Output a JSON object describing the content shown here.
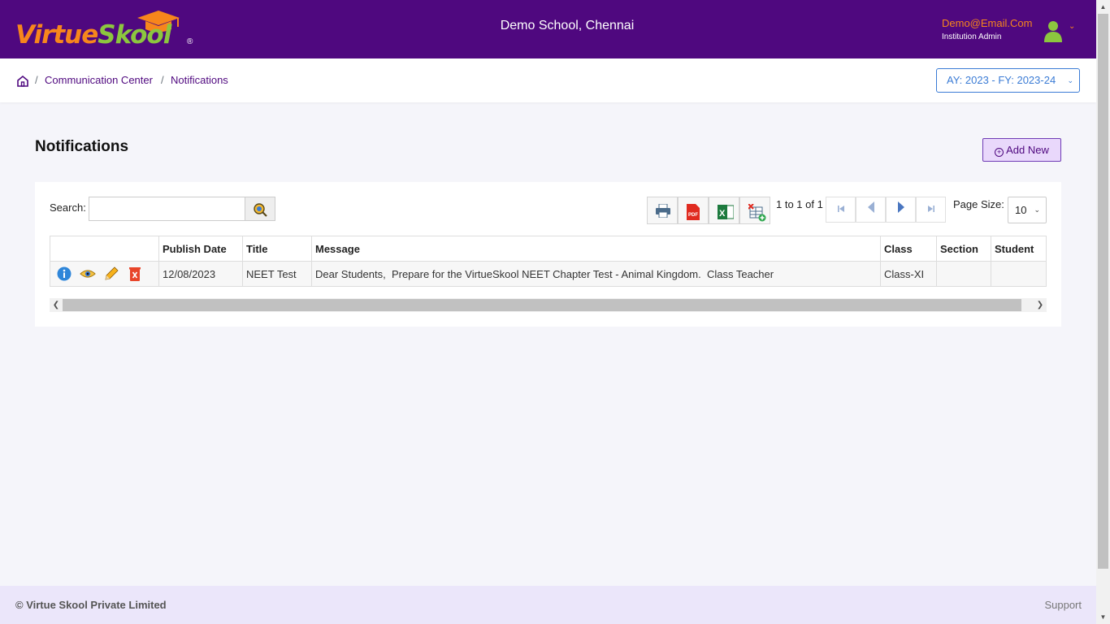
{
  "header": {
    "logo": {
      "part1": "Virtue",
      "part2": "Skool",
      "reg": "®"
    },
    "school_name": "Demo School, Chennai",
    "user_email": "Demo@Email.Com",
    "user_role": "Institution Admin"
  },
  "breadcrumb": {
    "items": [
      "Communication Center",
      "Notifications"
    ],
    "separator": "/"
  },
  "year_selector": {
    "value": "AY: 2023 - FY: 2023-24"
  },
  "main": {
    "title": "Notifications",
    "add_label": "Add New"
  },
  "grid": {
    "search_label": "Search:",
    "search_value": "",
    "pager_info": "1 to 1 of 1",
    "page_size_label": "Page Size:",
    "page_size": "10",
    "columns": [
      "",
      "Publish Date",
      "Title",
      "Message",
      "Class",
      "Section",
      "Student"
    ],
    "rows": [
      {
        "publish_date": "12/08/2023",
        "title": "NEET Test",
        "message": "Dear Students,  Prepare for the VirtueSkool NEET Chapter Test - Animal Kingdom.  Class Teacher",
        "class": "Class-XI",
        "section": "",
        "student": ""
      }
    ]
  },
  "footer": {
    "copyright": "© Virtue Skool Private Limited",
    "support": "Support"
  },
  "colors": {
    "brand_purple": "#4f087f",
    "brand_orange": "#f7861c",
    "brand_green": "#8cc63f",
    "link_blue": "#3a7bd5"
  }
}
